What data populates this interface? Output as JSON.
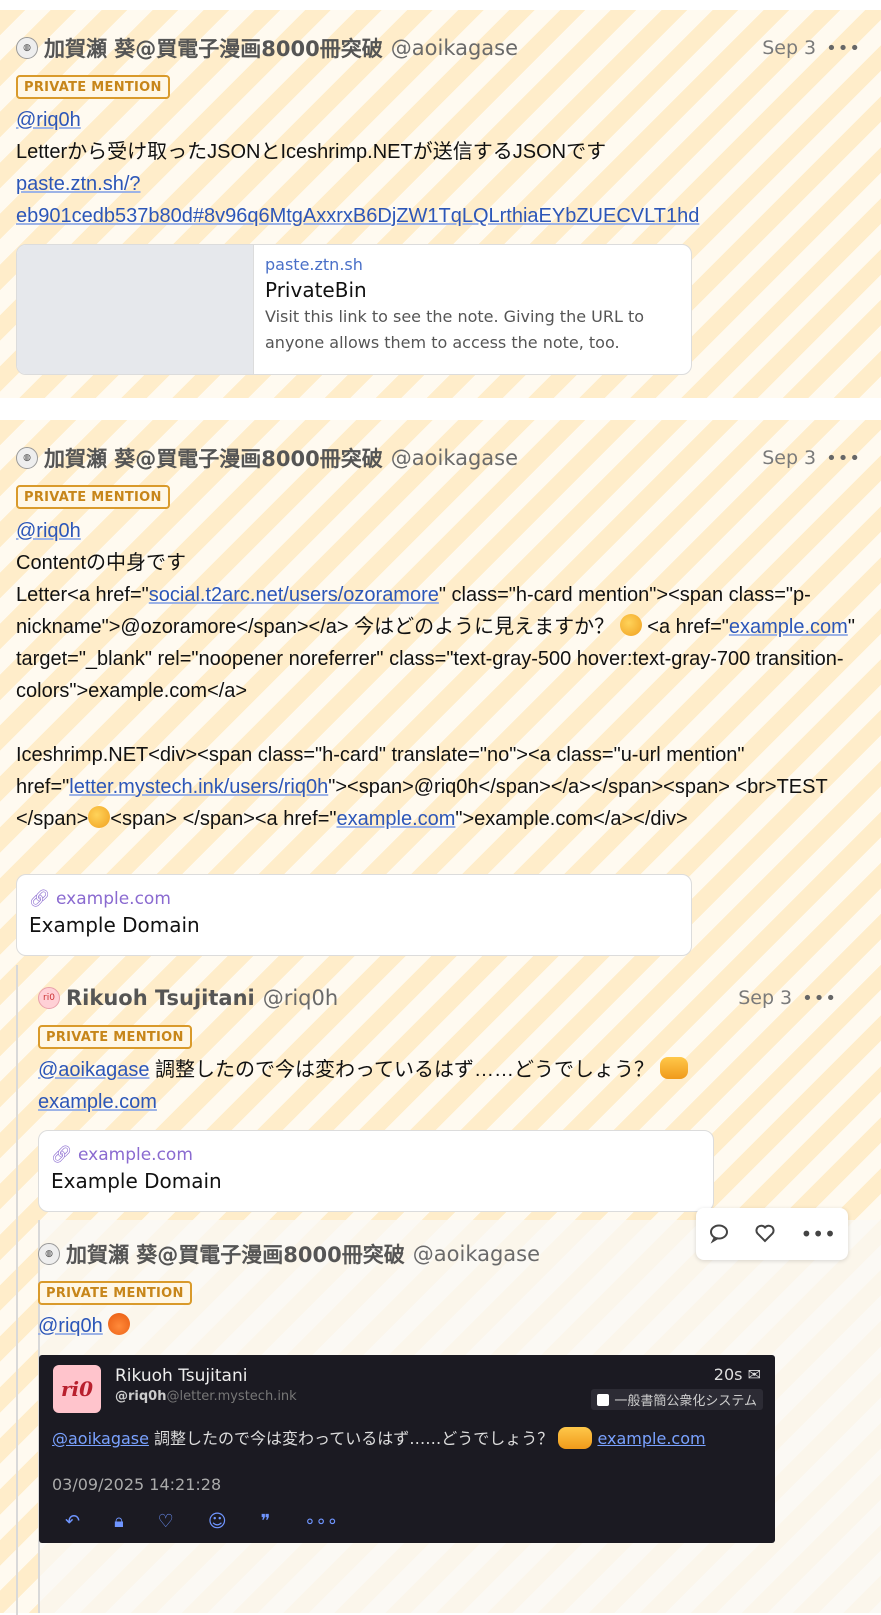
{
  "notes": [
    {
      "display_name": "加賀瀬 葵@買電子漫画8000冊突破",
      "handle": "@aoikagase",
      "time": "Sep 3",
      "visibility": "PRIVATE MENTION",
      "mention": "@riq0h",
      "line1": "Letterから受け取ったJSONとIceshrimp.NETが送信するJSONです",
      "link_line1": "paste.ztn.sh/?",
      "link_line2": "eb901cedb537b80d#8v96q6MtgAxxrxB6DjZW1TqLQLrthiaEYbZUECVLT1hd",
      "card": {
        "site": "paste.ztn.sh",
        "title": "PrivateBin",
        "desc": "Visit this link to see the note. Giving the URL to anyone allows them to access the note, too."
      }
    },
    {
      "display_name": "加賀瀬 葵@買電子漫画8000冊突破",
      "handle": "@aoikagase",
      "time": "Sep 3",
      "visibility": "PRIVATE MENTION",
      "mention": "@riq0h",
      "line1": "Contentの中身です",
      "p1_a": "Letter<a href=\"",
      "p1_link1": "social.t2arc.net/users/ozoramore",
      "p1_b": "\" class=\"h-card mention\"><span class=\"p-nickname\">@ozoramore</span></a> 今はどのように見えますか？ ",
      "p1_c": " <a href=\"",
      "p1_link2": "example.com",
      "p1_d": "\" target=\"_blank\" rel=\"noopener noreferrer\" class=\"text-gray-500 hover:text-gray-700 transition-colors\">example.com</a>",
      "p2_a": "Iceshrimp.NET<div><span class=\"h-card\" translate=\"no\"><a class=\"u-url mention\" href=\"",
      "p2_link1": "letter.mystech.ink/users/riq0h",
      "p2_b": "\"><span>@riq0h</span></a></span><span> <br>TEST </span>",
      "p2_c": "<span> </span><a href=\"",
      "p2_link2": "example.com",
      "p2_d": "\">example.com</a></div>",
      "card": {
        "site": "example.com",
        "title": "Example Domain"
      }
    },
    {
      "display_name": "Rikuoh Tsujitani",
      "handle": "@riq0h",
      "time": "Sep 3",
      "visibility": "PRIVATE MENTION",
      "mention": "@aoikagase",
      "text": " 調整したので今は変わっているはず……どうでしょう？",
      "link": "example.com",
      "card": {
        "site": "example.com",
        "title": "Example Domain"
      }
    },
    {
      "display_name": "加賀瀬 葵@買電子漫画8000冊突破",
      "handle": "@aoikagase",
      "visibility": "PRIVATE MENTION",
      "mention": "@riq0h"
    }
  ],
  "embedded_screenshot": {
    "name": "Rikuoh Tsujitani",
    "handle": "@riq0h",
    "domain": "@letter.mystech.ink",
    "age": "20s",
    "client": "一般書簡公衆化システム",
    "mention": "@aoikagase",
    "text": " 調整したので今は変わっているはず……どうでしょう？",
    "link": "example.com",
    "timestamp": "03/09/2025 14:21:28",
    "avatar_text": "ri0"
  },
  "icons": [
    "link-icon",
    "reply-icon",
    "like-icon",
    "more-icon",
    "mail-icon",
    "boost-icon",
    "emoji-icon",
    "quote-icon"
  ],
  "colors": {
    "accent": "#2c56b8",
    "badge": "#d99a2b",
    "stripe": "#ffe2aa"
  }
}
